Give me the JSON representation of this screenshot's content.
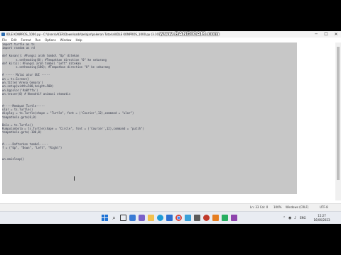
{
  "window": {
    "title": "IDLE KONPROS_1000.py - C:\\Users\\ACER\\Downloads\\belajar\\pakeran Tutorial\\IDLE KONPROS_1000.py (3.10.x)",
    "watermark": "www.BANDICAM.com",
    "min_glyph": "─",
    "max_glyph": "☐",
    "close_glyph": "✕"
  },
  "menu": [
    "File",
    "Edit",
    "Format",
    "Run",
    "Options",
    "Window",
    "Help"
  ],
  "editor": {
    "lines": [
      "import turtle as ts",
      "import random as rd",
      "",
      "def kanan(): #Fungsi arah tombol \"Up\" ditekan",
      "        s.setheading(0); #Tempatkan direction \"0\" ke sekarang",
      "def kiri(): #Fungsi arah tombol \"Left\" ditekan",
      "        s.setheading(180); #Tempatkan direction \"0\" ke sekarang",
      "",
      "# ----- Mulai atur GUI -----",
      "wn = ts.Screen()",
      "wn.title('Arena Cemara')",
      "wn.setup(width=500,height=500)",
      "wn.bgcolor('#a0fffa')",
      "wn.tracer(0) # Nonaktif animasi otomatis",
      "",
      "",
      "#-----Membuat Turtle-----",
      "ular = ts.Turtle()",
      "display = ts.Turtle(shape = \"Turtle\", font = ('Courier',12),command = \"ular\")",
      "tempatbola.goto(0,0)",
      "",
      "Bola = ts.Turtle()",
      "Kumpulanbola = ts.Turtle(shape = \"Circle\", font = ('Courier',12),command = \"putih\")",
      "tempatbola.goto(-100,0)",
      "",
      "",
      "#-----Daftarkan tombol-----",
      "f = (\"Up\", \"Down\", \"Left\", \"Right\")",
      "",
      "",
      "wn.mainloop()"
    ]
  },
  "status": {
    "position": "Ln: 33   Col: 0",
    "zoom": "100%",
    "eol": "Windows (CRLF)",
    "encoding": "UTF-8"
  },
  "taskbar": {
    "icons": [
      "start-icon",
      "search-icon",
      "task-view-icon",
      "widgets-icon",
      "chat-icon",
      "file-explorer-icon",
      "edge-icon",
      "store-icon",
      "chrome-icon",
      "notepad-icon"
    ],
    "search_glyph": "⌕",
    "chevron_glyph": "⌃",
    "net_glyph": "◉",
    "vol_glyph": "♪",
    "lang": "ENG",
    "time": "15:27",
    "date": "16/06/2023"
  }
}
